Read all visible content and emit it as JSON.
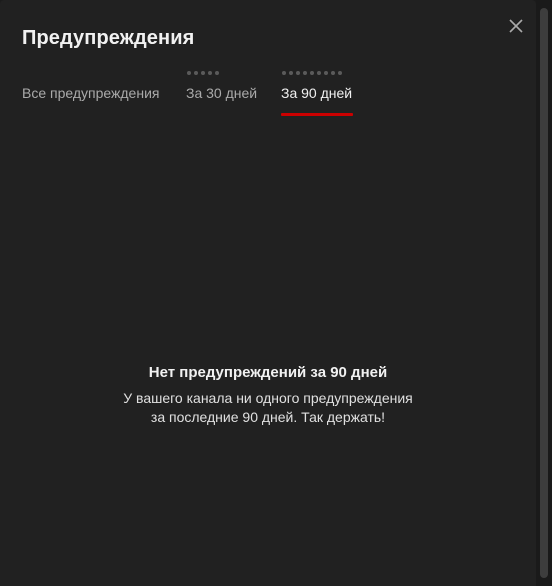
{
  "dialog": {
    "title": "Предупреждения",
    "close_icon": "close-icon"
  },
  "tabs": [
    {
      "label": "Все предупреждения",
      "active": false,
      "dots": 0
    },
    {
      "label": "За 30 дней",
      "active": false,
      "dots": 5
    },
    {
      "label": "За 90 дней",
      "active": true,
      "dots": 9
    }
  ],
  "empty_state": {
    "title": "Нет предупреждений за 90 дней",
    "line1": "У вашего канала ни одного предупреждения",
    "line2": "за последние 90 дней. Так держать!"
  },
  "colors": {
    "background": "#212121",
    "accent": "#cc0000",
    "text_primary": "#f1f1f1",
    "text_secondary": "#aaaaaa"
  }
}
